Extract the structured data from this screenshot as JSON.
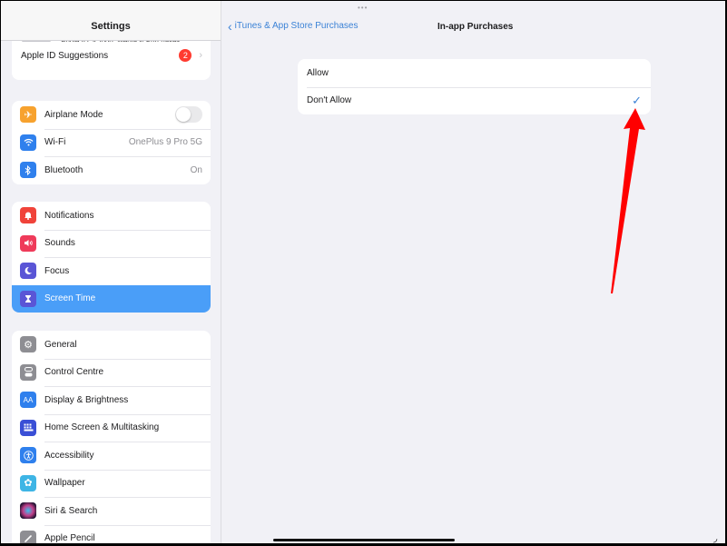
{
  "sidebar": {
    "title": "Settings",
    "account": {
      "subtitle": "Apple ID, iCloud, Media & Purchases",
      "suggestions_label": "Apple ID Suggestions",
      "suggestions_badge": "2"
    },
    "connectivity": [
      {
        "label": "Airplane Mode",
        "icon": "airplane-icon",
        "color": "#f7a22e",
        "toggle": false
      },
      {
        "label": "Wi-Fi",
        "icon": "wifi-icon",
        "color": "#2f80ed",
        "value": "OnePlus 9 Pro 5G"
      },
      {
        "label": "Bluetooth",
        "icon": "bluetooth-icon",
        "color": "#2f80ed",
        "value": "On"
      }
    ],
    "alerts": [
      {
        "label": "Notifications",
        "icon": "bell-icon",
        "color": "#f0433a"
      },
      {
        "label": "Sounds",
        "icon": "speaker-icon",
        "color": "#ef3b5a"
      },
      {
        "label": "Focus",
        "icon": "moon-icon",
        "color": "#5a55d6"
      },
      {
        "label": "Screen Time",
        "icon": "hourglass-icon",
        "color": "#5a55d6",
        "selected": true
      }
    ],
    "general": [
      {
        "label": "General",
        "icon": "gear-icon",
        "color": "#8e8e93"
      },
      {
        "label": "Control Centre",
        "icon": "switches-icon",
        "color": "#8e8e93"
      },
      {
        "label": "Display & Brightness",
        "icon": "text-size-icon",
        "color": "#2f80ed"
      },
      {
        "label": "Home Screen & Multitasking",
        "icon": "grid-icon",
        "color": "#3a4fd6"
      },
      {
        "label": "Accessibility",
        "icon": "accessibility-icon",
        "color": "#2f80ed"
      },
      {
        "label": "Wallpaper",
        "icon": "flower-icon",
        "color": "#3eb5e5"
      },
      {
        "label": "Siri & Search",
        "icon": "siri-icon",
        "color": "#2b1d3a"
      },
      {
        "label": "Apple Pencil",
        "icon": "pencil-icon",
        "color": "#8e8e93"
      }
    ]
  },
  "main": {
    "back_label": "iTunes & App Store Purchases",
    "title": "In-app Purchases",
    "options": [
      {
        "label": "Allow",
        "checked": false
      },
      {
        "label": "Don't Allow",
        "checked": true
      }
    ],
    "accent": "#3b82d6",
    "annotation_color": "#ff0000"
  }
}
